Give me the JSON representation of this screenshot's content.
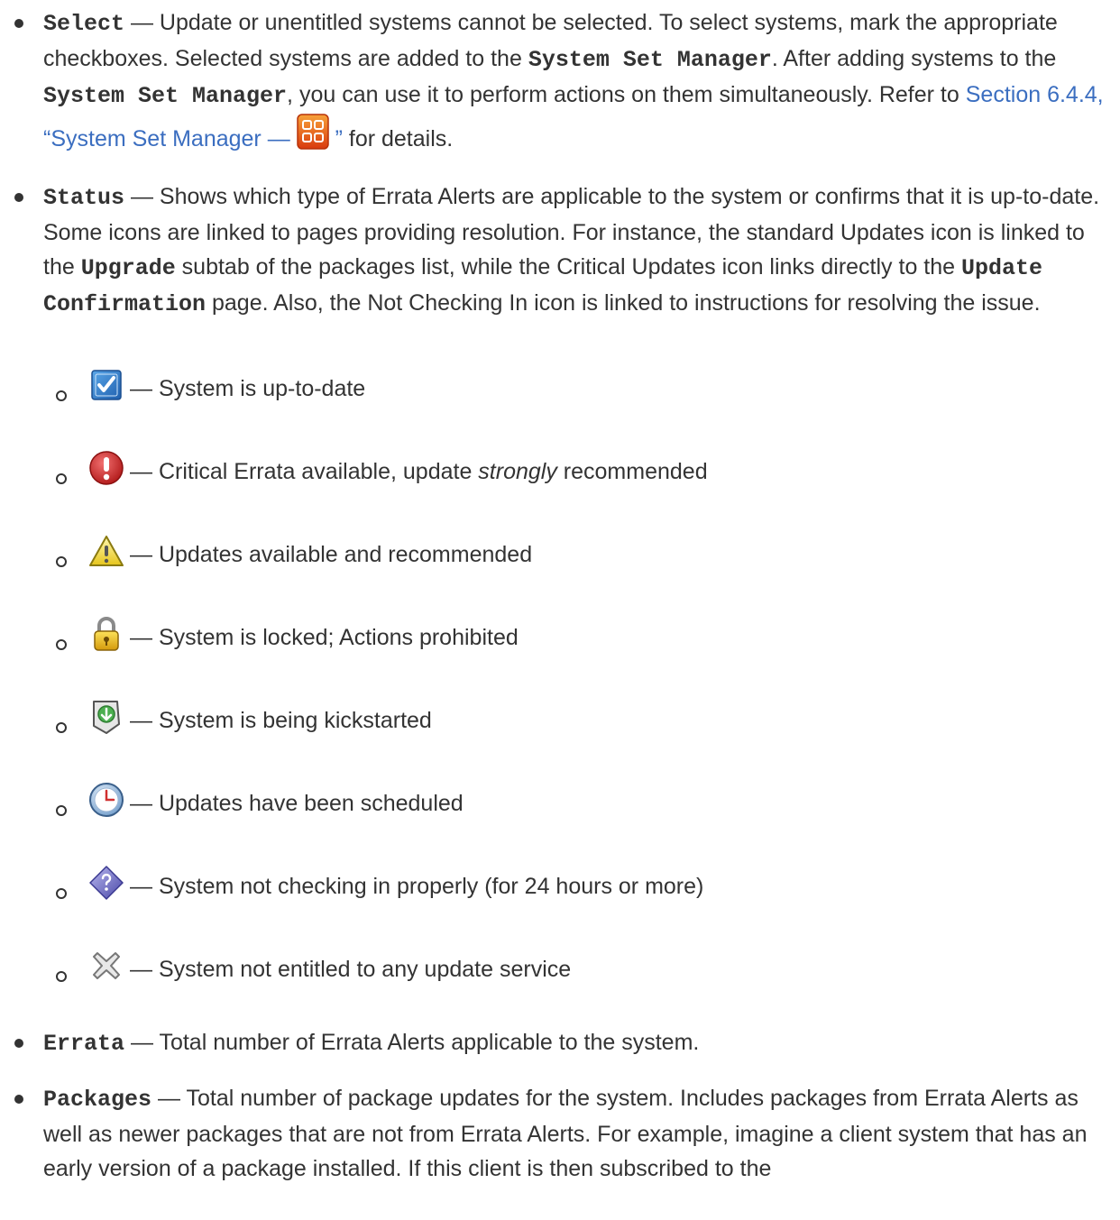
{
  "items": {
    "select": {
      "term": "Select",
      "text1": " — Update or unentitled systems cannot be selected. To select systems, mark the appropriate checkboxes. Selected systems are added to the ",
      "gui1": "System Set Manager",
      "text2": ". After adding systems to the ",
      "gui2": "System Set Manager",
      "text3": ", you can use it to perform actions on them simultaneously. Refer to ",
      "link": "Section 6.4.4, “System Set Manager — ",
      "link_end": " ”",
      "text4": " for details."
    },
    "status": {
      "term": "Status",
      "text1": " — Shows which type of Errata Alerts are applicable to the system or confirms that it is up-to-date. Some icons are linked to pages providing resolution. For instance, the standard Updates icon is linked to the ",
      "gui1": "Upgrade",
      "text2": " subtab of the packages list, while the Critical Updates icon links directly to the ",
      "gui2": "Update Confirmation",
      "text3": " page. Also, the Not Checking In icon is linked to instructions for resolving the issue."
    },
    "status_icons": [
      {
        "icon": "checkbox-check-icon",
        "text": " — System is up-to-date"
      },
      {
        "icon": "critical-alert-icon",
        "text_before": " — Critical Errata available, update ",
        "emphasis": "strongly",
        "text_after": " recommended"
      },
      {
        "icon": "warning-triangle-icon",
        "text": " — Updates available and recommended"
      },
      {
        "icon": "padlock-icon",
        "text": " — System is locked; Actions prohibited"
      },
      {
        "icon": "kickstart-icon",
        "text": " — System is being kickstarted"
      },
      {
        "icon": "clock-icon",
        "text": " — Updates have been scheduled"
      },
      {
        "icon": "question-diamond-icon",
        "text": " — System not checking in properly (for 24 hours or more)"
      },
      {
        "icon": "unentitled-x-icon",
        "text": " — System not entitled to any update service"
      }
    ],
    "errata": {
      "term": "Errata",
      "text": " — Total number of Errata Alerts applicable to the system."
    },
    "packages": {
      "term": "Packages",
      "text": " — Total number of package updates for the system. Includes packages from Errata Alerts as well as newer packages that are not from Errata Alerts. For example, imagine a client system that has an early version of a package installed. If this client is then subscribed to the"
    }
  },
  "colors": {
    "link": "#3b6ec0",
    "text": "#333333",
    "ssm_icon": "#e8541b"
  }
}
